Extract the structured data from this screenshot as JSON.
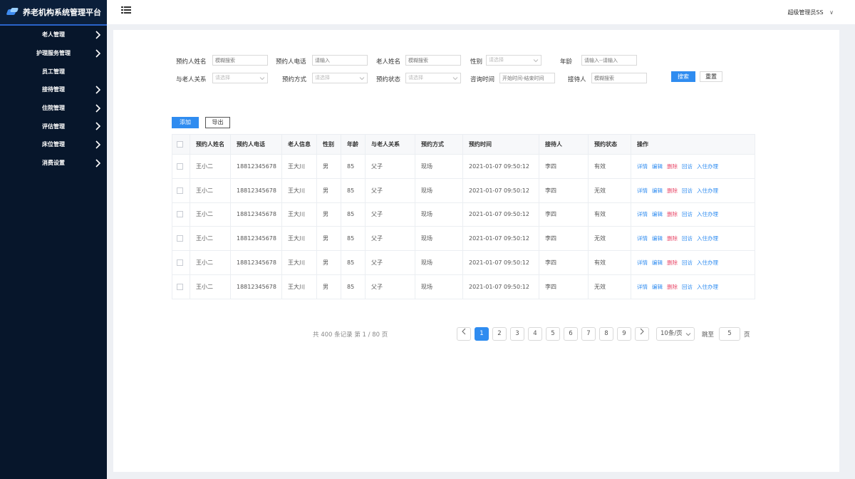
{
  "app": {
    "title": "养老机构系统管理平台"
  },
  "sidebar": {
    "items": [
      {
        "label": "老人管理",
        "expandable": true
      },
      {
        "label": "护理服务管理",
        "expandable": true
      },
      {
        "label": "员工管理",
        "expandable": false
      },
      {
        "label": "接待管理",
        "expandable": true
      },
      {
        "label": "住院管理",
        "expandable": true
      },
      {
        "label": "评估管理",
        "expandable": true
      },
      {
        "label": "床位管理",
        "expandable": true
      },
      {
        "label": "消费设置",
        "expandable": true
      }
    ]
  },
  "header": {
    "user": "超级管理员SS"
  },
  "filters": {
    "booker_name": {
      "label": "预约人姓名",
      "placeholder": "模糊搜索"
    },
    "booker_phone": {
      "label": "预约人电话",
      "placeholder": "请输入"
    },
    "elder_name": {
      "label": "老人姓名",
      "placeholder": "模糊搜索"
    },
    "gender": {
      "label": "性别",
      "placeholder": "请选择"
    },
    "age": {
      "label": "年龄",
      "placeholder": "请输入--请输入"
    },
    "relation": {
      "label": "与老人关系",
      "placeholder": "请选择"
    },
    "method": {
      "label": "预约方式",
      "placeholder": "请选择"
    },
    "status": {
      "label": "预约状态",
      "placeholder": "请选择"
    },
    "consult_time": {
      "label": "咨询时间",
      "placeholder": "开始时间-结束时间"
    },
    "receptionist": {
      "label": "接待人",
      "placeholder": "模糊搜索"
    },
    "search_label": "搜索",
    "reset_label": "重置"
  },
  "toolbar": {
    "add_label": "添加",
    "export_label": "导出"
  },
  "table": {
    "columns": [
      "预约人姓名",
      "预约人电话",
      "老人信息",
      "性别",
      "年龄",
      "与老人关系",
      "预约方式",
      "预约时间",
      "接待人",
      "预约状态",
      "操作"
    ],
    "rows": [
      {
        "booker": "王小二",
        "phone": "18812345678",
        "elder": "王大川",
        "gender": "男",
        "age": "85",
        "relation": "父子",
        "method": "现场",
        "time": "2021-01-07  09:50:12",
        "receptionist": "李四",
        "status": "有效"
      },
      {
        "booker": "王小二",
        "phone": "18812345678",
        "elder": "王大川",
        "gender": "男",
        "age": "85",
        "relation": "父子",
        "method": "现场",
        "time": "2021-01-07  09:50:12",
        "receptionist": "李四",
        "status": "无效"
      },
      {
        "booker": "王小二",
        "phone": "18812345678",
        "elder": "王大川",
        "gender": "男",
        "age": "85",
        "relation": "父子",
        "method": "现场",
        "time": "2021-01-07  09:50:12",
        "receptionist": "李四",
        "status": "有效"
      },
      {
        "booker": "王小二",
        "phone": "18812345678",
        "elder": "王大川",
        "gender": "男",
        "age": "85",
        "relation": "父子",
        "method": "现场",
        "time": "2021-01-07  09:50:12",
        "receptionist": "李四",
        "status": "无效"
      },
      {
        "booker": "王小二",
        "phone": "18812345678",
        "elder": "王大川",
        "gender": "男",
        "age": "85",
        "relation": "父子",
        "method": "现场",
        "time": "2021-01-07  09:50:12",
        "receptionist": "李四",
        "status": "有效"
      },
      {
        "booker": "王小二",
        "phone": "18812345678",
        "elder": "王大川",
        "gender": "男",
        "age": "85",
        "relation": "父子",
        "method": "现场",
        "time": "2021-01-07  09:50:12",
        "receptionist": "李四",
        "status": "无效"
      }
    ],
    "actions": [
      {
        "label": "详情",
        "color": "#2f8cf0"
      },
      {
        "label": "编辑",
        "color": "#2f8cf0"
      },
      {
        "label": "删除",
        "color": "#e84a6a"
      },
      {
        "label": "回访",
        "color": "#2f8cf0"
      },
      {
        "label": "入住办理",
        "color": "#2f8cf0"
      }
    ]
  },
  "pagination": {
    "summary": "共 400 条记录 第 1 / 80 页",
    "pages": [
      "1",
      "2",
      "3",
      "4",
      "5",
      "6",
      "7",
      "8",
      "9"
    ],
    "current": "1",
    "page_size": "10条/页",
    "jump_label": "跳至",
    "jump_value": "5",
    "jump_unit": "页"
  },
  "colors": {
    "sidebar_bg": "#07162b",
    "primary": "#2f8cf0",
    "danger": "#e84a6a"
  }
}
